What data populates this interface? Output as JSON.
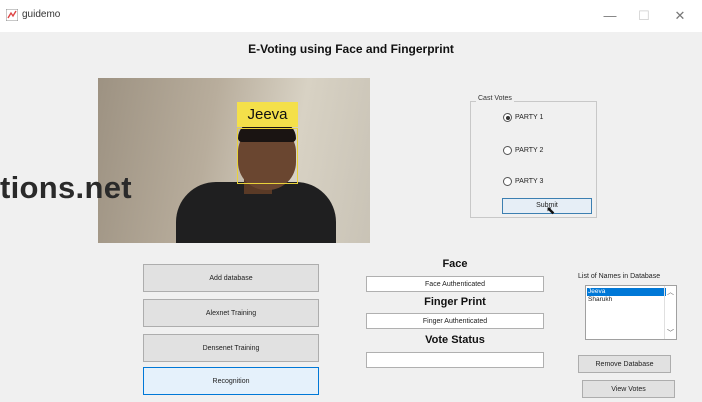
{
  "window": {
    "title": "guidemo",
    "minimize_glyph": "—",
    "maximize_glyph": "☐",
    "close_glyph": "✕"
  },
  "heading": "E-Voting using Face and Fingerprint",
  "video": {
    "face_label": "Jeeva",
    "watermark": "tions.net"
  },
  "cast_votes": {
    "legend": "Cast Votes",
    "options": [
      {
        "label": "PARTY 1",
        "selected": true
      },
      {
        "label": "PARTY 2",
        "selected": false
      },
      {
        "label": "PARTY 3",
        "selected": false
      }
    ],
    "submit_label": "Submit"
  },
  "left_buttons": {
    "add_database": "Add database",
    "alexnet_training": "Alexnet Training",
    "densenet_training": "Densenet Training",
    "recognition": "Recognition"
  },
  "middle": {
    "face_heading": "Face",
    "face_status": "Face Authenticated",
    "finger_heading": "Finger Print",
    "finger_status": "Finger Authenticated",
    "vote_heading": "Vote Status",
    "vote_status": ""
  },
  "names_list": {
    "caption": "List of Names  in Database",
    "items": [
      "Jeeva",
      "Sharukh"
    ],
    "selected_index": 0
  },
  "right_buttons": {
    "remove_database": "Remove Database",
    "view_votes": "View Votes"
  },
  "colors": {
    "face_box": "#e9d23a",
    "selection": "#0078d7"
  }
}
